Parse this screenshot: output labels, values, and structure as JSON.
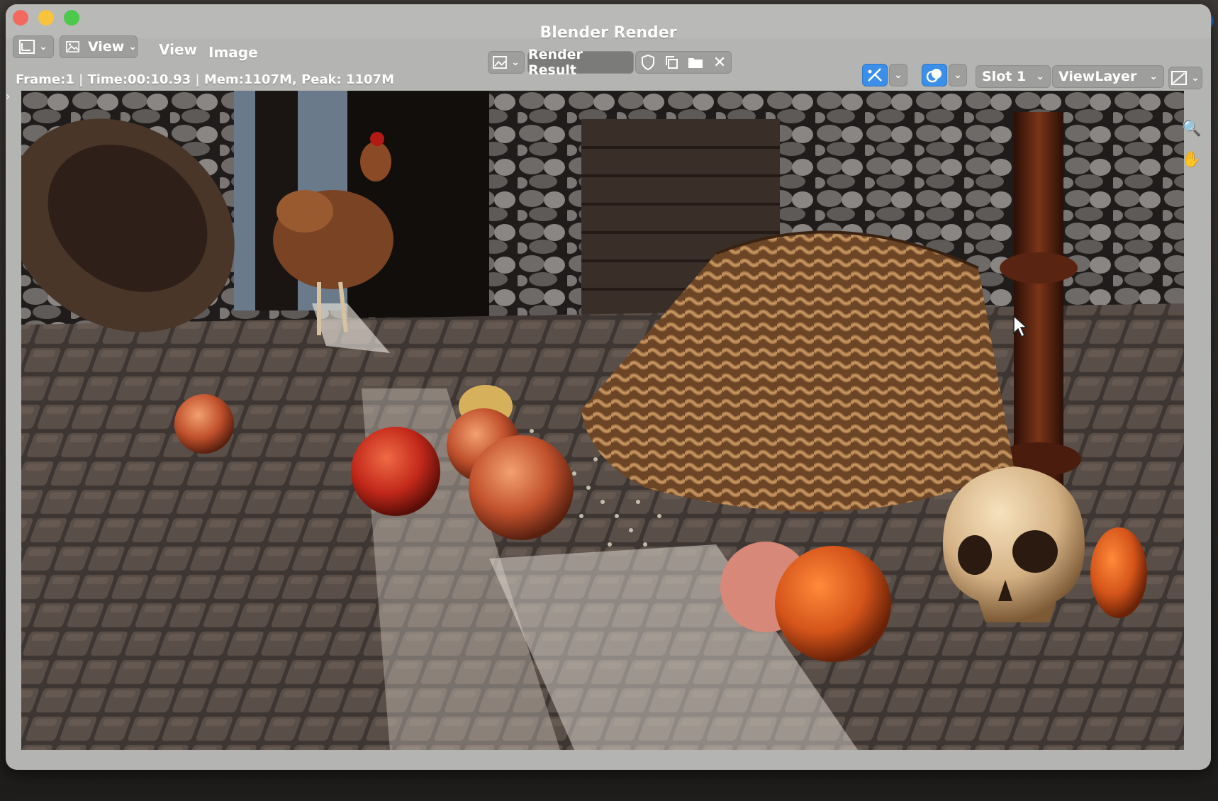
{
  "window": {
    "title": "Blender Render"
  },
  "toolbar": {
    "editor_type_icon": "image-editor-icon",
    "view_dropdown_icon": "image-icon",
    "view_dropdown_label": "View",
    "menu_view": "View",
    "menu_image": "Image",
    "image_browse_icon": "image-browse-icon",
    "image_name": "Render Result",
    "fake_user_icon": "shield-icon",
    "duplicate_icon": "copy-icon",
    "open_icon": "folder-icon",
    "unlink_icon": "close-icon",
    "gizmo_icon": "gizmo-icon",
    "overlay_icon": "overlay-icon",
    "slot_label": "Slot 1",
    "view_layer_label": "ViewLayer",
    "display_channels_icon": "display-channels-icon"
  },
  "status": {
    "frame": "Frame:1",
    "time": "Time:00:10.93",
    "memory": "Mem:1107M, Peak: 1107M"
  },
  "side_tools": {
    "zoom_icon": "zoom-icon",
    "pan_icon": "hand-icon"
  },
  "colors": {
    "window_chrome": "#b4b4b2",
    "accent_blue": "#3c8fe8",
    "close_red": "#f26a5e",
    "minimize_yellow": "#f7c43b",
    "zoom_green": "#4cc84a"
  }
}
